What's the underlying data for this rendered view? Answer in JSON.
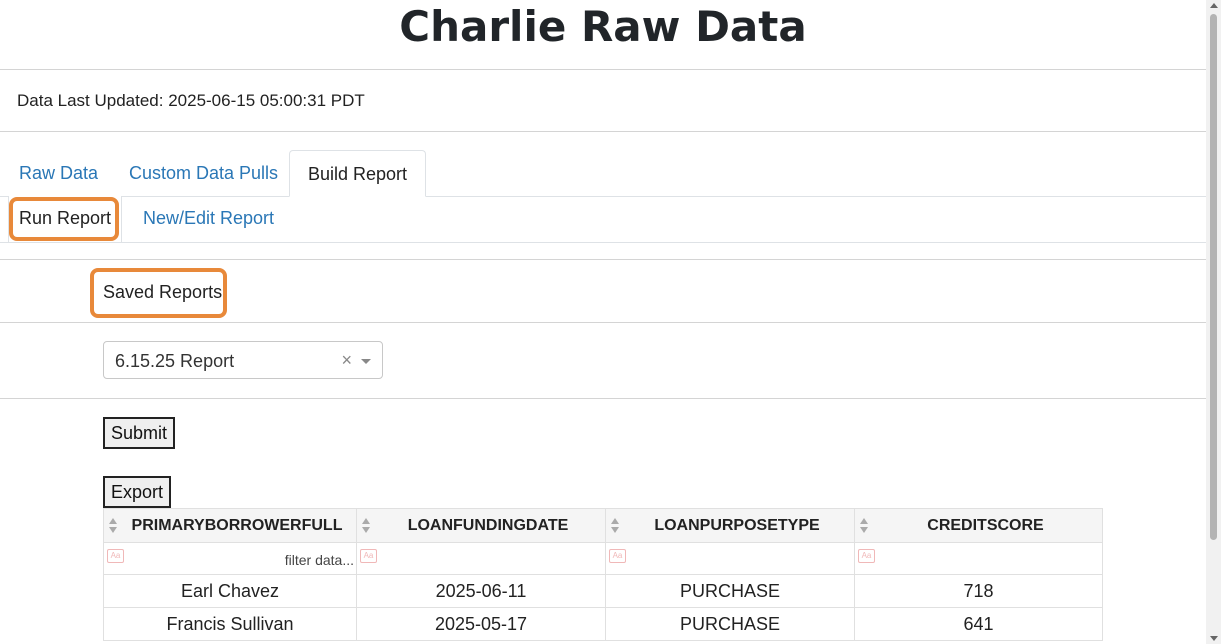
{
  "page_title": "Charlie Raw Data",
  "data_last_updated": "Data Last Updated: 2025-06-15 05:00:31 PDT",
  "tabs": [
    {
      "label": "Raw Data",
      "active": false
    },
    {
      "label": "Custom Data Pulls",
      "active": false
    },
    {
      "label": "Build Report",
      "active": true
    }
  ],
  "subtabs": [
    {
      "label": "Run Report",
      "active": true
    },
    {
      "label": "New/Edit Report",
      "active": false
    }
  ],
  "saved_reports": {
    "label": "Saved Reports",
    "selected": "6.15.25 Report",
    "clear_symbol": "×"
  },
  "buttons": {
    "submit": "Submit",
    "export": "Export"
  },
  "table": {
    "columns": [
      "PRIMARYBORROWERFULL",
      "LOANFUNDINGDATE",
      "LOANPURPOSETYPE",
      "CREDITSCORE"
    ],
    "filter_icon": "Aa",
    "filter_placeholder": "filter data...",
    "rows": [
      [
        "Earl Chavez",
        "2025-06-11",
        "PURCHASE",
        "718"
      ],
      [
        "Francis Sullivan",
        "2025-05-17",
        "PURCHASE",
        "641"
      ]
    ]
  },
  "colors": {
    "highlight": "#e8893a",
    "link": "#2a77b6"
  }
}
